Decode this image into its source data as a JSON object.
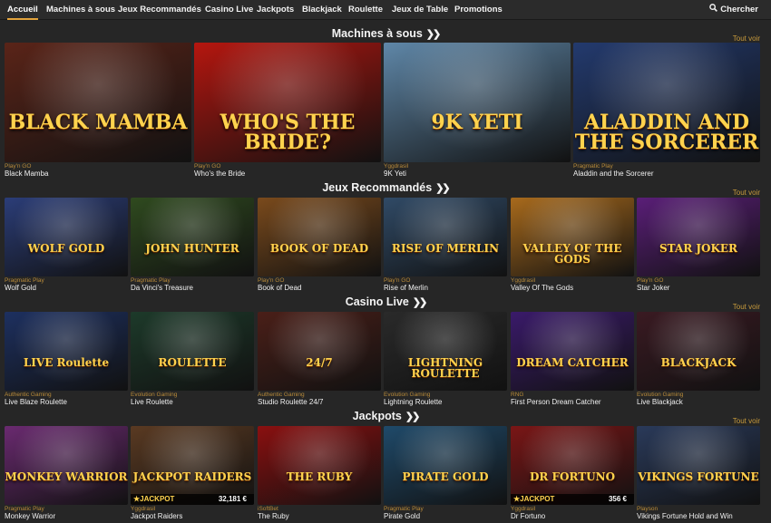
{
  "nav": {
    "items": [
      "Accueil",
      "Machines à sous",
      "Jeux Recommandés",
      "Casino Live",
      "Jackpots",
      "Blackjack",
      "Roulette",
      "Jeux de Table",
      "Promotions"
    ],
    "search_label": "Chercher",
    "search_icon": "search-icon"
  },
  "colors": {
    "accent": "#e2a33c",
    "provider": "#b98b3a",
    "see_all": "#c79a3c",
    "background": "#262626"
  },
  "see_all_label": "Tout voir",
  "sections": [
    {
      "title": "Machines à sous",
      "games": [
        {
          "provider": "Play'n GO",
          "name": "Black Mamba",
          "art": "BLACK MAMBA",
          "bg": "#5a2418"
        },
        {
          "provider": "Play'n GO",
          "name": "Who's the Bride",
          "art": "WHO'S THE BRIDE?",
          "bg": "#b5160f"
        },
        {
          "provider": "Yggdrasil",
          "name": "9K Yeti",
          "art": "9K YETI",
          "bg": "#5f87a8"
        },
        {
          "provider": "Pragmatic Play",
          "name": "Aladdin and the Sorcerer",
          "art": "ALADDIN AND THE SORCERER",
          "bg": "#233a6e"
        }
      ]
    },
    {
      "title": "Jeux Recommandés",
      "games": [
        {
          "provider": "Pragmatic Play",
          "name": "Wolf Gold",
          "art": "WOLF GOLD",
          "bg": "#2b3d78"
        },
        {
          "provider": "Pragmatic Play",
          "name": "Da Vinci's Treasure",
          "art": "JOHN HUNTER",
          "bg": "#2f4a1f"
        },
        {
          "provider": "Play'n GO",
          "name": "Book of Dead",
          "art": "BOOK OF DEAD",
          "bg": "#7a4a1c"
        },
        {
          "provider": "Play'n GO",
          "name": "Rise of Merlin",
          "art": "RISE OF MERLIN",
          "bg": "#304a66"
        },
        {
          "provider": "Yggdrasil",
          "name": "Valley Of The Gods",
          "art": "VALLEY OF THE GODS",
          "bg": "#a86a1c"
        },
        {
          "provider": "Play'n GO",
          "name": "Star Joker",
          "art": "STAR JOKER",
          "bg": "#5a1e78"
        }
      ]
    },
    {
      "title": "Casino Live",
      "games": [
        {
          "provider": "Authentic Gaming",
          "name": "Live Blaze Roulette",
          "art": "LIVE Roulette",
          "bg": "#1d3060"
        },
        {
          "provider": "Evolution Gaming",
          "name": "Live Roulette",
          "art": "ROULETTE",
          "bg": "#1d3a2a"
        },
        {
          "provider": "Authentic Gaming",
          "name": "Studio Roulette 24/7",
          "art": "24/7",
          "bg": "#4a1f18"
        },
        {
          "provider": "Evolution Gaming",
          "name": "Lightning Roulette",
          "art": "LIGHTNING ROULETTE",
          "bg": "#2a2a2a"
        },
        {
          "provider": "RNG",
          "name": "First Person Dream Catcher",
          "art": "DREAM CATCHER",
          "bg": "#3a1a6a"
        },
        {
          "provider": "Evolution Gaming",
          "name": "Live Blackjack",
          "art": "BLACKJACK",
          "bg": "#3a1a22"
        }
      ]
    },
    {
      "title": "Jackpots",
      "games": [
        {
          "provider": "Pragmatic Play",
          "name": "Monkey Warrior",
          "art": "MONKEY WARRIOR",
          "bg": "#6a2a70",
          "jackpot": ""
        },
        {
          "provider": "Yggdrasil",
          "name": "Jackpot Raiders",
          "art": "JACKPOT RAIDERS",
          "bg": "#5a3a22",
          "jackpot": "32,181 €"
        },
        {
          "provider": "iSoftBet",
          "name": "The Ruby",
          "art": "THE RUBY",
          "bg": "#8a1010",
          "jackpot": ""
        },
        {
          "provider": "Pragmatic Play",
          "name": "Pirate Gold",
          "art": "PIRATE GOLD",
          "bg": "#1f4a6a",
          "jackpot": ""
        },
        {
          "provider": "Yggdrasil",
          "name": "Dr Fortuno",
          "art": "DR FORTUNO",
          "bg": "#7a1616",
          "jackpot": "356 €"
        },
        {
          "provider": "Playson",
          "name": "Vikings Fortune Hold and Win",
          "art": "VIKINGS FORTUNE",
          "bg": "#2a3a5a",
          "jackpot": ""
        }
      ]
    }
  ],
  "jackpot_label": "JACKPOT"
}
